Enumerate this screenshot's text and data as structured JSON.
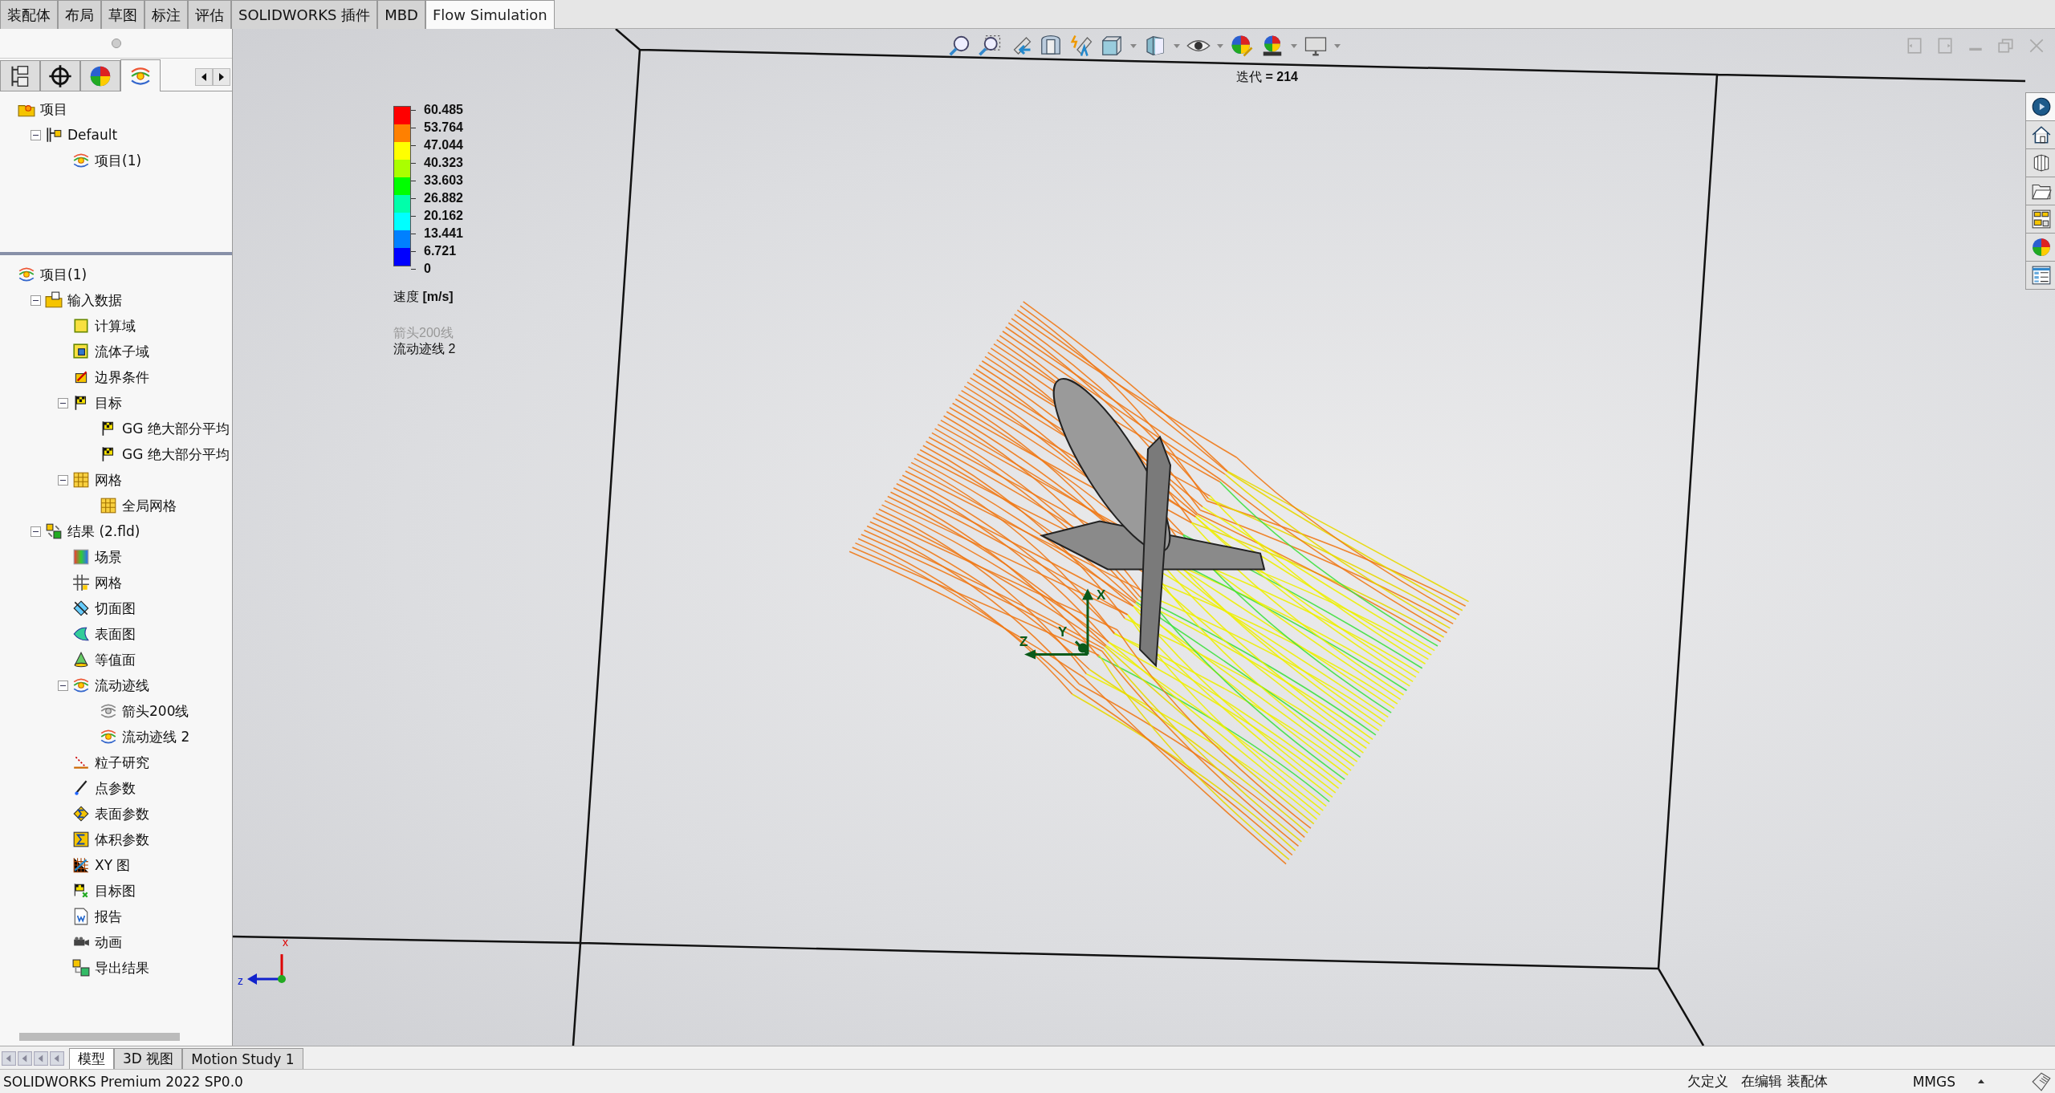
{
  "command_tabs": [
    {
      "label": "装配体",
      "selected": false
    },
    {
      "label": "布局",
      "selected": false
    },
    {
      "label": "草图",
      "selected": false
    },
    {
      "label": "标注",
      "selected": false
    },
    {
      "label": "评估",
      "selected": false
    },
    {
      "label": "SOLIDWORKS 插件",
      "selected": false
    },
    {
      "label": "MBD",
      "selected": false
    },
    {
      "label": "Flow Simulation",
      "selected": true
    }
  ],
  "panel_tabs": [
    {
      "kind": "tree",
      "selected": false
    },
    {
      "kind": "target",
      "selected": false
    },
    {
      "kind": "appearance",
      "selected": false
    },
    {
      "kind": "flow",
      "selected": true
    }
  ],
  "upper_tree": [
    {
      "label": "项目",
      "kind": "project-folder",
      "children": [
        {
          "label": "Default",
          "kind": "config",
          "expanded": true,
          "children": [
            {
              "label": "项目(1)",
              "kind": "flow"
            }
          ]
        }
      ]
    }
  ],
  "lower_tree": [
    {
      "label": "项目(1)",
      "kind": "flow",
      "children": [
        {
          "label": "输入数据",
          "kind": "folder",
          "expanded": true,
          "children": [
            {
              "label": "计算域",
              "kind": "domain"
            },
            {
              "label": "流体子域",
              "kind": "subdomain"
            },
            {
              "label": "边界条件",
              "kind": "boundary"
            },
            {
              "label": "目标",
              "kind": "goal",
              "expanded": true,
              "children": [
                {
                  "label": "GG 绝大部分平均",
                  "kind": "goal"
                },
                {
                  "label": "GG 绝大部分平均",
                  "kind": "goal"
                }
              ]
            },
            {
              "label": "网格",
              "kind": "mesh",
              "expanded": true,
              "children": [
                {
                  "label": "全局网格",
                  "kind": "mesh"
                }
              ]
            }
          ]
        },
        {
          "label": "结果 (2.fld)",
          "kind": "results",
          "expanded": true,
          "children": [
            {
              "label": "场景",
              "kind": "scene"
            },
            {
              "label": "网格",
              "kind": "grid"
            },
            {
              "label": "切面图",
              "kind": "cut"
            },
            {
              "label": "表面图",
              "kind": "surface"
            },
            {
              "label": "等值面",
              "kind": "iso"
            },
            {
              "label": "流动迹线",
              "kind": "flow",
              "expanded": true,
              "children": [
                {
                  "label": "箭头200线",
                  "kind": "flow-off"
                },
                {
                  "label": "流动迹线 2",
                  "kind": "flow"
                }
              ]
            },
            {
              "label": "粒子研究",
              "kind": "particle"
            },
            {
              "label": "点参数",
              "kind": "point"
            },
            {
              "label": "表面参数",
              "kind": "surfparam"
            },
            {
              "label": "体积参数",
              "kind": "volparam"
            },
            {
              "label": "XY 图",
              "kind": "xy"
            },
            {
              "label": "目标图",
              "kind": "goalplot"
            },
            {
              "label": "报告",
              "kind": "report"
            },
            {
              "label": "动画",
              "kind": "animation"
            },
            {
              "label": "导出结果",
              "kind": "export"
            }
          ]
        }
      ]
    }
  ],
  "viewport": {
    "iteration": "迭代 **= 214**",
    "legend": {
      "ticks": [
        "60.485",
        "53.764",
        "47.044",
        "40.323",
        "33.603",
        "26.882",
        "20.162",
        "13.441",
        "6.721",
        "0"
      ],
      "bands": [
        {
          "color": "#ff0000"
        },
        {
          "color": "#ff8000"
        },
        {
          "color": "#ffff00"
        },
        {
          "color": "#aaff00"
        },
        {
          "color": "#00ff00"
        },
        {
          "color": "#00ffaa"
        },
        {
          "color": "#00ffff"
        },
        {
          "color": "#0080ff"
        },
        {
          "color": "#0000ff"
        }
      ],
      "title": "速度 **[m/s]**",
      "plots": [
        {
          "label": "箭头200线",
          "active": false
        },
        {
          "label": "流动迹线 2",
          "active": true
        }
      ]
    },
    "triad": {
      "x": "X",
      "y": "Y",
      "z": "Z"
    },
    "corner_triad": {
      "x": "x",
      "z": "z"
    }
  },
  "bottom_tabs": [
    {
      "label": "模型",
      "selected": true
    },
    {
      "label": "3D 视图",
      "selected": false
    },
    {
      "label": "Motion Study 1",
      "selected": false
    }
  ],
  "status_bar": {
    "product": "SOLIDWORKS Premium 2022 SP0.0",
    "definition": "欠定义",
    "mode": "在编辑 装配体",
    "units": "MMGS"
  }
}
